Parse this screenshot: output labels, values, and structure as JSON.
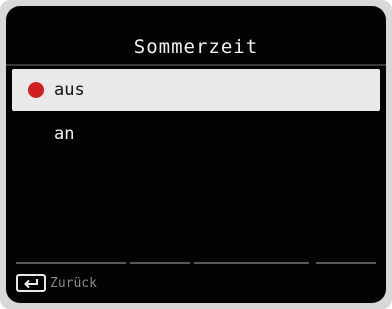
{
  "screen": {
    "title": "Sommerzeit"
  },
  "menu": {
    "items": [
      {
        "label": "aus",
        "selected": true
      },
      {
        "label": "an",
        "selected": false
      }
    ]
  },
  "footer": {
    "back_label": "Zurück",
    "back_icon": "return-arrow-icon"
  },
  "colors": {
    "selection_dot": "#d11f1f",
    "background": "#030303",
    "highlight": "#e9e9e9"
  }
}
